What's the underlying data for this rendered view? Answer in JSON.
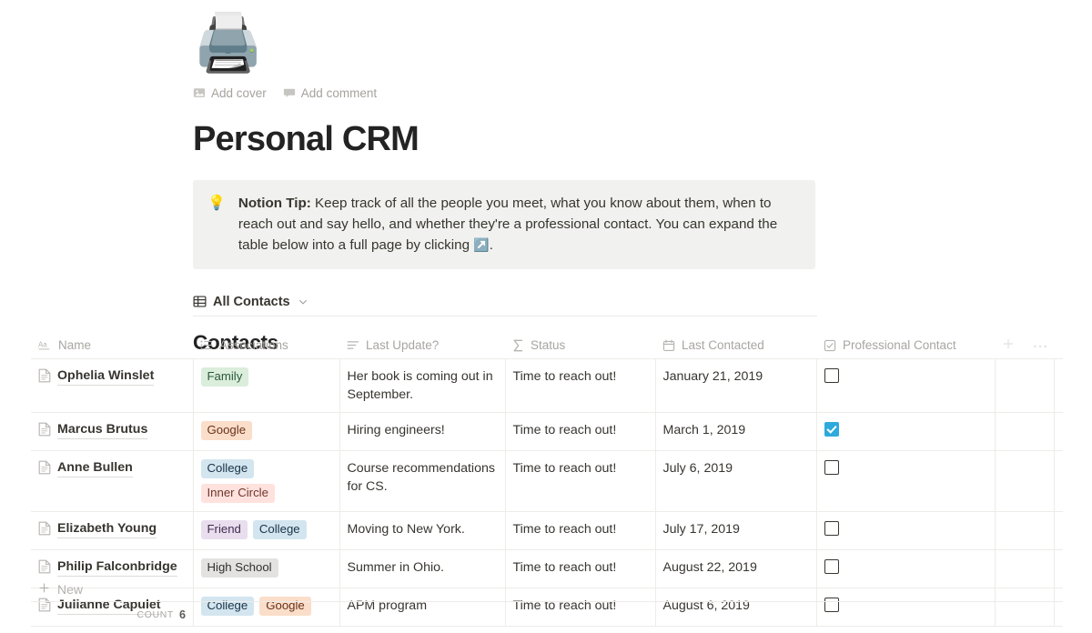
{
  "page": {
    "emoji": "🖨️",
    "title": "Personal CRM",
    "add_cover_label": "Add cover",
    "add_comment_label": "Add comment"
  },
  "callout": {
    "emoji": "💡",
    "bold_prefix": "Notion Tip:",
    "text": " Keep track of all the people you meet, what you know about them, when to reach out and say hello, and whether they're a professional contact. You can expand the table below into a full page by clicking ",
    "inline_emoji": "↗️",
    "text_end": "."
  },
  "view": {
    "name": "All Contacts",
    "table_icon": "table-icon",
    "chevron_icon": "chevron-down-icon"
  },
  "collection": {
    "title": "Contacts",
    "columns": [
      {
        "label": "Name",
        "icon": "text-aa-icon"
      },
      {
        "label": "Associations",
        "icon": "multi-select-icon"
      },
      {
        "label": "Last Update?",
        "icon": "text-lines-icon"
      },
      {
        "label": "Status",
        "icon": "formula-sigma-icon"
      },
      {
        "label": "Last Contacted",
        "icon": "calendar-icon"
      },
      {
        "label": "Professional Contact",
        "icon": "checkbox-icon"
      }
    ],
    "header_actions": [
      {
        "icon": "plus-icon",
        "name": "add-column-button"
      },
      {
        "icon": "ellipsis-icon",
        "name": "column-options-button"
      }
    ],
    "rows": [
      {
        "name": "Ophelia Winslet",
        "associations": [
          {
            "label": "Family",
            "color": "green"
          }
        ],
        "last_update": "Her book is coming out in September.",
        "status": "Time to reach out!",
        "last_contacted": "January 21, 2019",
        "professional_contact": false
      },
      {
        "name": "Marcus Brutus",
        "associations": [
          {
            "label": "Google",
            "color": "orange"
          }
        ],
        "last_update": "Hiring engineers!",
        "status": "Time to reach out!",
        "last_contacted": "March 1, 2019",
        "professional_contact": true
      },
      {
        "name": "Anne Bullen",
        "associations": [
          {
            "label": "College",
            "color": "blue"
          },
          {
            "label": "Inner Circle",
            "color": "red"
          }
        ],
        "last_update": "Course recommendations for CS.",
        "status": "Time to reach out!",
        "last_contacted": "July 6, 2019",
        "professional_contact": false
      },
      {
        "name": "Elizabeth Young",
        "associations": [
          {
            "label": "Friend",
            "color": "purple"
          },
          {
            "label": "College",
            "color": "blue"
          }
        ],
        "last_update": "Moving to New York.",
        "status": "Time to reach out!",
        "last_contacted": "July 17, 2019",
        "professional_contact": false
      },
      {
        "name": "Philip Falconbridge",
        "associations": [
          {
            "label": "High School",
            "color": "gray"
          }
        ],
        "last_update": "Summer in Ohio.",
        "status": "Time to reach out!",
        "last_contacted": "August 22, 2019",
        "professional_contact": false
      },
      {
        "name": "Julianne Capulet",
        "associations": [
          {
            "label": "College",
            "color": "blue"
          },
          {
            "label": "Google",
            "color": "orange"
          }
        ],
        "last_update": "APM program",
        "status": "Time to reach out!",
        "last_contacted": "August 6, 2019",
        "professional_contact": false
      }
    ],
    "new_row_label": "New",
    "count_label": "COUNT",
    "count_value": "6"
  },
  "colors": {
    "accent_checkbox": "#2eaadc",
    "callout_bg": "#f1f1ef",
    "border": "#edece9",
    "muted_text": "#a8a6a1"
  }
}
